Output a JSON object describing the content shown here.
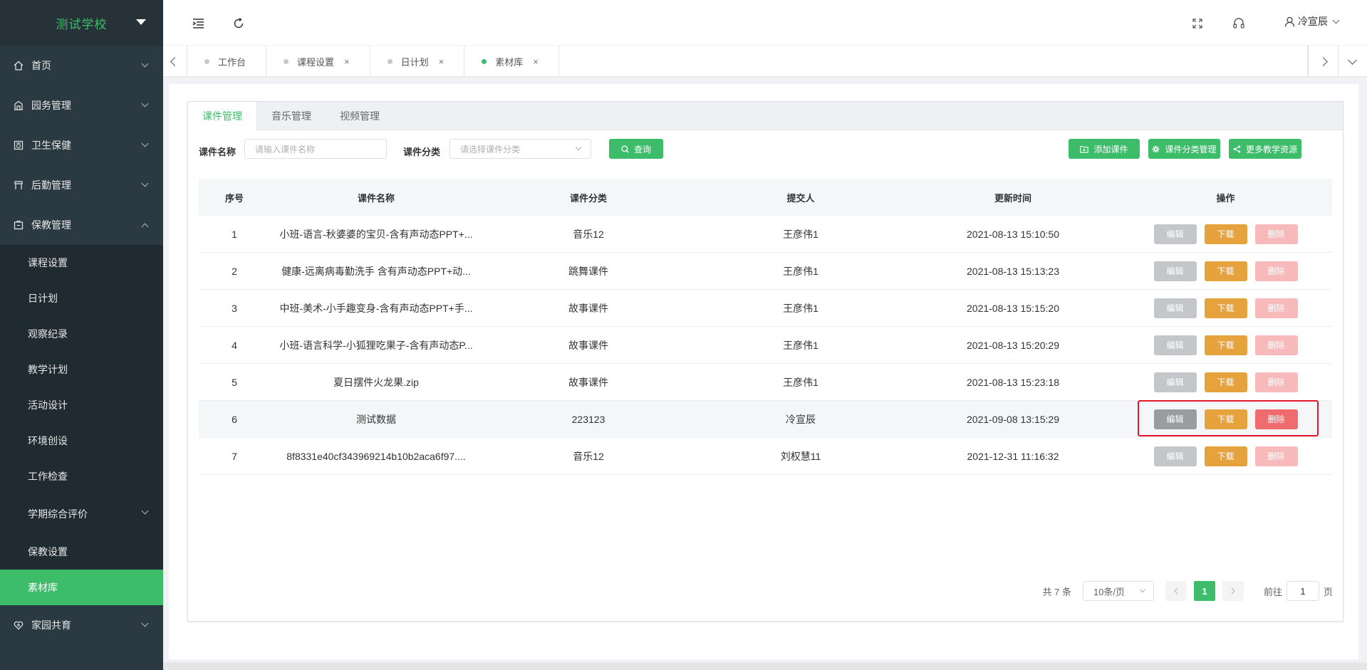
{
  "brand": {
    "name": "测试学校"
  },
  "sidebar": {
    "items": [
      {
        "label": "首页",
        "icon": "home-icon"
      },
      {
        "label": "园务管理",
        "icon": "building-icon"
      },
      {
        "label": "卫生保健",
        "icon": "health-icon"
      },
      {
        "label": "后勤管理",
        "icon": "logistics-icon"
      },
      {
        "label": "保教管理",
        "icon": "education-icon"
      }
    ],
    "sub_items": [
      {
        "label": "课程设置"
      },
      {
        "label": "日计划"
      },
      {
        "label": "观察纪录"
      },
      {
        "label": "教学计划"
      },
      {
        "label": "活动设计"
      },
      {
        "label": "环境创设"
      },
      {
        "label": "工作检查"
      },
      {
        "label": "学期综合评价"
      },
      {
        "label": "保教设置"
      },
      {
        "label": "素材库"
      }
    ],
    "after": {
      "label": "家园共育",
      "icon": "heart-icon"
    }
  },
  "header": {
    "user_name": "冷宣辰"
  },
  "tabs": [
    {
      "label": "工作台",
      "closable": false
    },
    {
      "label": "课程设置",
      "closable": true
    },
    {
      "label": "日计划",
      "closable": true
    },
    {
      "label": "素材库",
      "closable": true,
      "active": true
    }
  ],
  "close_glyph": "×",
  "panel_tabs": [
    {
      "label": "课件管理"
    },
    {
      "label": "音乐管理"
    },
    {
      "label": "视频管理"
    }
  ],
  "filters": {
    "name_label": "课件名称",
    "name_placeholder": "请输入课件名称",
    "category_label": "课件分类",
    "category_placeholder": "请选择课件分类",
    "search_label": "查询"
  },
  "toolbar": {
    "add_label": "添加课件",
    "category_manage_label": "课件分类管理",
    "more_label": "更多教学资源"
  },
  "table": {
    "headers": [
      "序号",
      "课件名称",
      "课件分类",
      "提交人",
      "更新时间",
      "操作"
    ],
    "rows": [
      {
        "no": "1",
        "name": "小班-语言-秋婆婆的宝贝-含有声动态PPT+...",
        "category": "音乐12",
        "submitter": "王彦伟1",
        "updated": "2021-08-13 15:10:50"
      },
      {
        "no": "2",
        "name": "健康-远离病毒勤洗手 含有声动态PPT+动...",
        "category": "跳舞课件",
        "submitter": "王彦伟1",
        "updated": "2021-08-13 15:13:23"
      },
      {
        "no": "3",
        "name": "中班-美术-小手趣变身-含有声动态PPT+手...",
        "category": "故事课件",
        "submitter": "王彦伟1",
        "updated": "2021-08-13 15:15:20"
      },
      {
        "no": "4",
        "name": "小班-语言科学-小狐狸吃果子-含有声动态P...",
        "category": "故事课件",
        "submitter": "王彦伟1",
        "updated": "2021-08-13 15:20:29"
      },
      {
        "no": "5",
        "name": "夏日摆件火龙果.zip",
        "category": "故事课件",
        "submitter": "王彦伟1",
        "updated": "2021-08-13 15:23:18"
      },
      {
        "no": "6",
        "name": "测试数据",
        "category": "223123",
        "submitter": "冷宣辰",
        "updated": "2021-09-08 13:15:29"
      },
      {
        "no": "7",
        "name": "8f8331e40cf343969214b10b2aca6f97....",
        "category": "音乐12",
        "submitter": "刘权慧11",
        "updated": "2021-12-31 11:16:32"
      }
    ],
    "actions": {
      "edit": "编辑",
      "download": "下载",
      "delete": "删除"
    }
  },
  "pagination": {
    "total": "共 7 条",
    "page_size": "10条/页",
    "current_page": "1",
    "goto_prefix": "前往",
    "goto_value": "1",
    "goto_suffix": "页"
  },
  "colors": {
    "accent": "#3dbd6a",
    "sidebar_bg": "#2b3a42",
    "warning": "#e6a23c",
    "danger": "#ef6c6e"
  }
}
